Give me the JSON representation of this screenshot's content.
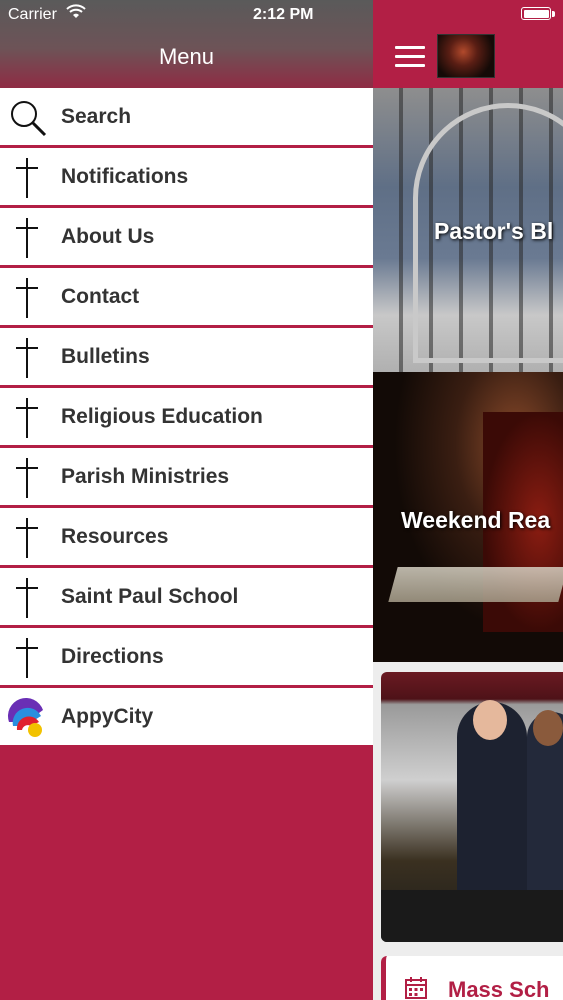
{
  "status_bar": {
    "carrier": "Carrier",
    "time": "2:12 PM"
  },
  "drawer": {
    "title": "Menu",
    "items": [
      {
        "label": "Search",
        "icon": "search-icon"
      },
      {
        "label": "Notifications",
        "icon": "cross-icon"
      },
      {
        "label": "About Us",
        "icon": "cross-icon"
      },
      {
        "label": "Contact",
        "icon": "cross-icon"
      },
      {
        "label": "Bulletins",
        "icon": "cross-icon"
      },
      {
        "label": "Religious Education",
        "icon": "cross-icon"
      },
      {
        "label": "Parish Ministries",
        "icon": "cross-icon"
      },
      {
        "label": "Resources",
        "icon": "cross-icon"
      },
      {
        "label": "Saint Paul School",
        "icon": "cross-icon"
      },
      {
        "label": "Directions",
        "icon": "cross-icon"
      },
      {
        "label": "AppyCity",
        "icon": "appycity-logo-icon"
      }
    ]
  },
  "content": {
    "tiles": {
      "blog_title": "Pastor's Bl",
      "readings_title": "Weekend Rea",
      "mass_title": "Mass Sch"
    }
  },
  "colors": {
    "brand": "#b21f45",
    "menu_text": "#333333",
    "header_gradient_top": "#5a5a5a"
  }
}
